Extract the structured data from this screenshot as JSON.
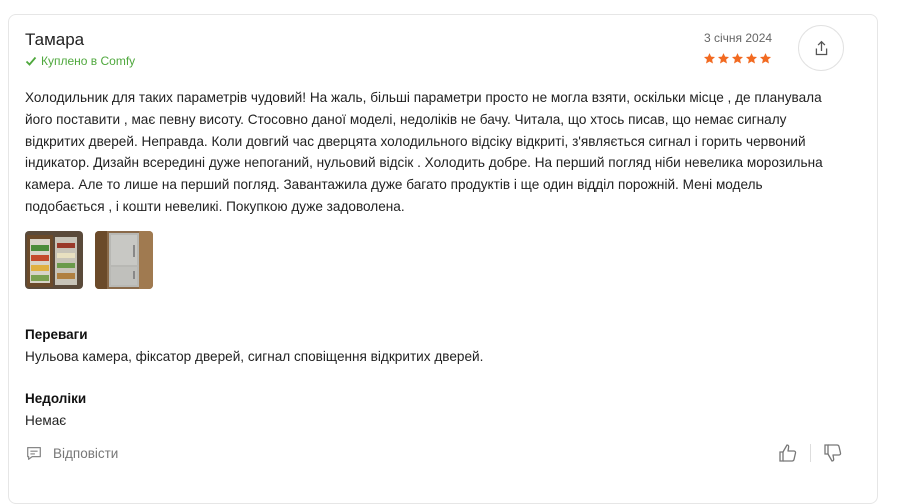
{
  "review": {
    "author": "Тамара",
    "verified_label": "Куплено в Comfy",
    "date": "3 січня 2024",
    "rating": 5,
    "rating_max": 5,
    "text": "Холодильник для таких параметрів чудовий! На жаль, більші параметри просто не могла взяти, оскільки місце , де планувала його поставити , має певну висоту. Стосовно даної моделі, недоліків не бачу. Читала, що хтось писав, що немає сигналу відкритих дверей. Неправда. Коли довгий час дверцята холодильного відсіку відкриті, з'являється сигнал і горить червоний індикатор. Дизайн всередині дуже непоганий, нульовий відсік . Холодить добре. На перший погляд ніби невелика морозильна камера. Але то лише на перший погляд. Завантажила дуже багато продуктів і ще один відділ порожній. Мені модель подобається , і кошти невеликі. Покупкою дуже задоволена.",
    "pros_title": "Переваги",
    "pros_text": "Нульова камера, фіксатор дверей, сигнал сповіщення відкритих дверей.",
    "cons_title": "Недоліки",
    "cons_text": "Немає",
    "reply_label": "Відповісти"
  },
  "colors": {
    "verified": "#4fa83d",
    "star": "#f26a21",
    "muted": "#777777"
  },
  "icons": {
    "verified": "check-icon",
    "share": "share-icon",
    "reply": "comment-icon",
    "like": "thumbs-up-icon",
    "dislike": "thumbs-down-icon"
  }
}
